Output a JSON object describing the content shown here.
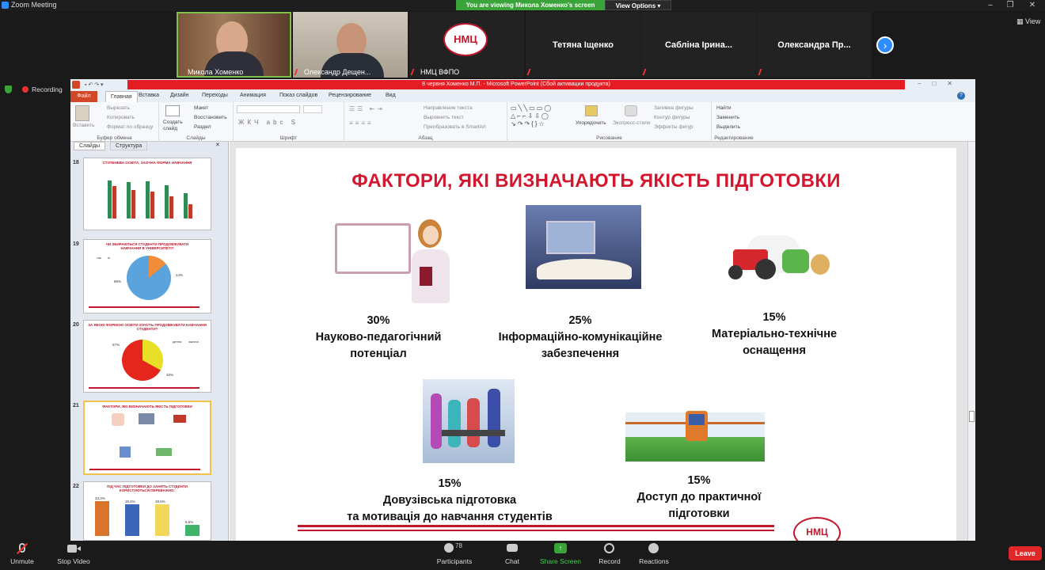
{
  "window": {
    "title": "Zoom Meeting"
  },
  "share_banner": {
    "text": "You are viewing Микола Хоменко's screen",
    "view_options": "View Options"
  },
  "view_label": "View",
  "participants_thumbs": [
    {
      "name": "Микола Хоменко"
    },
    {
      "name": "Олександр Дещен..."
    },
    {
      "name": "НМЦ ВФПО"
    },
    {
      "name": "Тетяна Іщенко"
    },
    {
      "name": "Сабліна Ірина..."
    },
    {
      "name": "Олександра  Пр..."
    }
  ],
  "logo_text": "НМЦ",
  "recording": "Recording",
  "ppt": {
    "title": "8 червня Хоменко М.П. - Microsoft PowerPoint (Сбой активации продукта)",
    "file_tab": "Файл",
    "tabs": [
      "Главная",
      "Вставка",
      "Дизайн",
      "Переходы",
      "Анимация",
      "Показ слайдов",
      "Рецензирование",
      "Вид"
    ],
    "ribbon": {
      "clipboard": {
        "paste": "Вставить",
        "cut": "Вырезать",
        "copy": "Копировать",
        "format": "Формат по образцу",
        "label": "Буфер обмена"
      },
      "slides": {
        "create": "Создать слайд",
        "layout": "Макет",
        "restore": "Восстановить",
        "section": "Раздел",
        "label": "Слайды"
      },
      "font": {
        "label": "Шрифт"
      },
      "paragraph": {
        "direction": "Направление текста",
        "align": "Выровнять текст",
        "smartart": "Преобразовать в SmartArt",
        "label": "Абзац"
      },
      "drawing": {
        "arrange": "Упорядочить",
        "styles": "Экспресс-стили",
        "fill": "Заливка фигуры",
        "outline": "Контур фигуры",
        "effects": "Эффекты фигур",
        "label": "Рисование"
      },
      "editing": {
        "find": "Найти",
        "replace": "Заменить",
        "select": "Выделить",
        "label": "Редактирование"
      }
    },
    "pane_tabs": [
      "Слайды",
      "Структура"
    ],
    "thumbs": [
      {
        "num": "18",
        "title": "СТУПЕНЕВА ОСВІТА, ЗАОЧНА ФОРМА НАВЧАННЯ"
      },
      {
        "num": "19",
        "title": "ЧИ ЗБИРАЮТЬСЯ СТУДЕНТИ ПРОДОВЖУВАТИ НАВЧАННЯ В УНІВЕРСИТЕТІ?",
        "v1": "86%",
        "v2": "14%",
        "l1": "так",
        "l2": "ні"
      },
      {
        "num": "20",
        "title": "ЗА ЯКОЮ ФОРМОЮ ОСВІТИ ХОЧУТЬ ПРОДОВЖУВАТИ НАВЧАННЯ СТУДЕНТИ?",
        "v1": "67%",
        "v2": "33%",
        "l1": "денна",
        "l2": "заочна"
      },
      {
        "num": "21",
        "title": "ФАКТОРИ, ЯКІ ВИЗНАЧАЮТЬ ЯКІСТЬ ПІДГОТОВКИ"
      },
      {
        "num": "22",
        "title": "ПІД ЧАС ПІДГОТОВКИ ДО ЗАНЯТЬ СТУДЕНТИ КОРИСТУЮТЬСЯ ПЕРЕВАЖНО:",
        "values": [
          "33,3%",
          "28,6%",
          "28,6%",
          "9,5%"
        ]
      }
    ],
    "slide": {
      "title": "ФАКТОРИ, ЯКІ ВИЗНАЧАЮТЬ ЯКІСТЬ ПІДГОТОВКИ",
      "factors": [
        {
          "pct": "30%",
          "line1": "Науково-педагогічний",
          "line2": "потенціал"
        },
        {
          "pct": "25%",
          "line1": "Інформаційно-комунікаційне",
          "line2": "забезпечення"
        },
        {
          "pct": "15%",
          "line1": "Матеріально-технічне",
          "line2": "оснащення"
        },
        {
          "pct": "15%",
          "line1": "Довузівська підготовка",
          "line2": "та мотивація до навчання студентів"
        },
        {
          "pct": "15%",
          "line1": "Доступ до практичної",
          "line2": "підготовки"
        }
      ]
    }
  },
  "bottom": {
    "unmute": "Unmute",
    "stop_video": "Stop Video",
    "participants": "Participants",
    "participants_count": "78",
    "chat": "Chat",
    "share": "Share Screen",
    "record": "Record",
    "reactions": "Reactions",
    "leave": "Leave"
  },
  "colors": {
    "zoom_blue": "#2d8cff",
    "share_green": "#3aa43a",
    "slide_red": "#d3172e",
    "leave_red": "#e02828"
  }
}
